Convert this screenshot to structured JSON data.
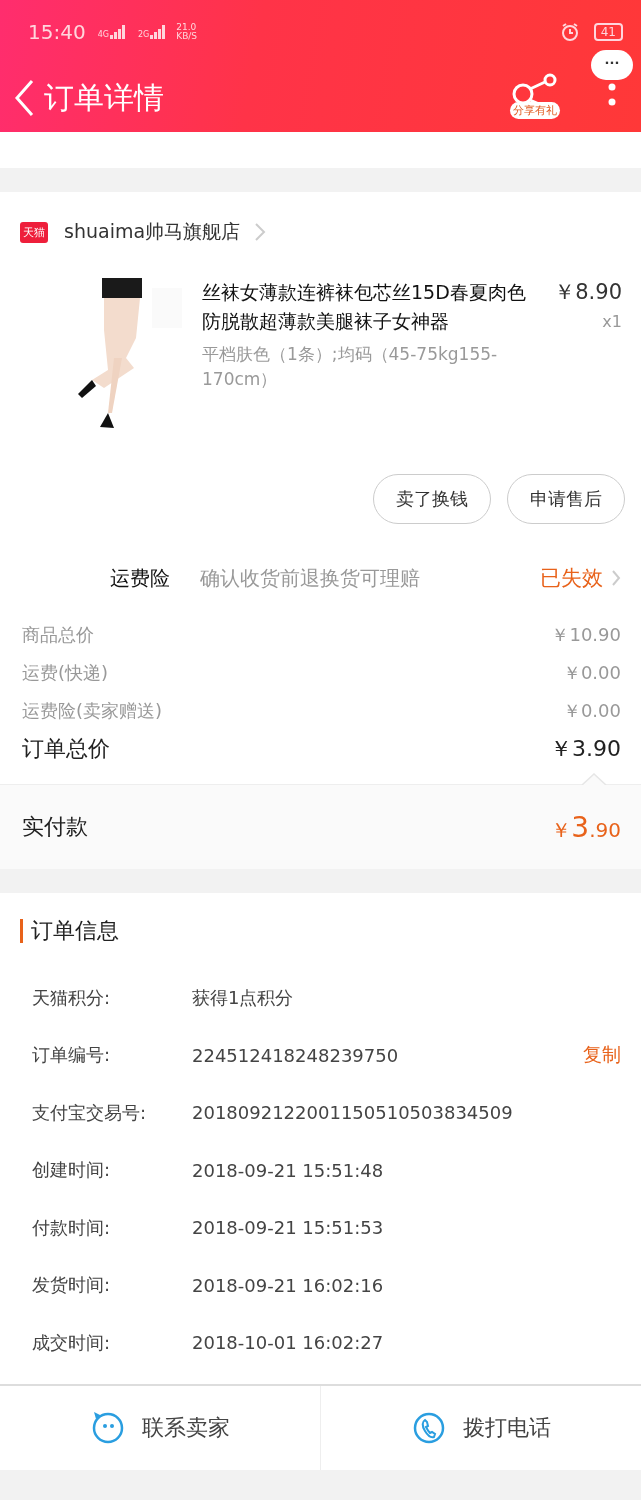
{
  "status_bar": {
    "time": "15:40",
    "net1": "4G",
    "net2": "2G",
    "speed": "21.0",
    "speed_unit": "KB/S",
    "battery": "41"
  },
  "header": {
    "title": "订单详情",
    "share_label": "分享有礼",
    "more": "···"
  },
  "store": {
    "badge": "天猫",
    "name": "shuaima帅马旗舰店"
  },
  "product": {
    "title": "丝袜女薄款连裤袜包芯丝15D春夏肉色防脱散超薄款美腿袜子女神器",
    "price": "￥8.90",
    "quantity": "x1",
    "sku": "平档肤色（1条）;均码（45-75kg155-170cm）"
  },
  "actions": [
    "卖了换钱",
    "申请售后"
  ],
  "insurance": {
    "label": "运费险",
    "desc": "确认收货前退换货可理赔",
    "status": "已失效"
  },
  "price_rows": [
    {
      "label": "商品总价",
      "value": "￥10.90",
      "emphasis": false
    },
    {
      "label": "运费(快递)",
      "value": "￥0.00",
      "emphasis": false
    },
    {
      "label": "运费险(卖家赠送)",
      "value": "￥0.00",
      "emphasis": false
    },
    {
      "label": "订单总价",
      "value": "￥3.90",
      "emphasis": true
    }
  ],
  "paid": {
    "label": "实付款",
    "currency": "￥",
    "integer": "3",
    "decimal": ".90"
  },
  "order_info": {
    "title": "订单信息",
    "rows": [
      {
        "label": "天猫积分:",
        "value": "获得1点积分"
      },
      {
        "label": "订单编号:",
        "value": "224512418248239750",
        "action": "复制"
      },
      {
        "label": "支付宝交易号:",
        "value": "2018092122001150510503834509"
      },
      {
        "label": "创建时间:",
        "value": "2018-09-21 15:51:48"
      },
      {
        "label": "付款时间:",
        "value": "2018-09-21 15:51:53"
      },
      {
        "label": "发货时间:",
        "value": "2018-09-21 16:02:16"
      },
      {
        "label": "成交时间:",
        "value": "2018-10-01 16:02:27"
      }
    ]
  },
  "bottom_bar": [
    {
      "kind": "chat",
      "label": "联系卖家"
    },
    {
      "kind": "phone",
      "label": "拨打电话"
    }
  ]
}
